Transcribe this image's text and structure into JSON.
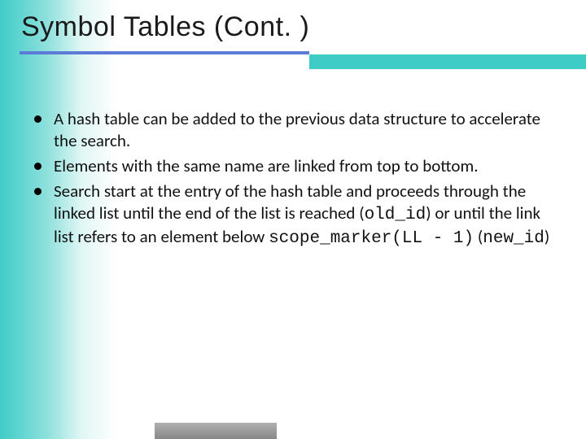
{
  "slide": {
    "title": "Symbol Tables (Cont. )",
    "bullets": [
      {
        "pre": "A hash table can be added to the previous data structure to accelerate the search."
      },
      {
        "pre": "Elements with the same name are linked from top to bottom."
      },
      {
        "pre": "Search start at the entry of the hash table and proceeds through the linked list until the end of the list is reached (",
        "code1": "old_id",
        "mid1": ") or until the link list refers to an element below ",
        "code2": "scope_marker(LL - 1)",
        "mid2": " (",
        "code3": "new_id",
        "post": ")"
      }
    ]
  }
}
